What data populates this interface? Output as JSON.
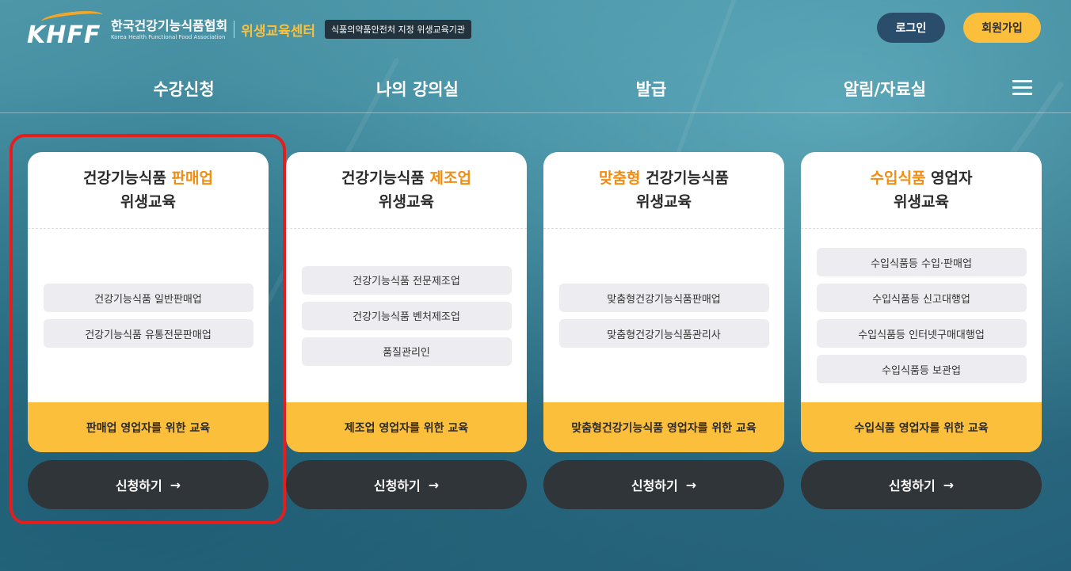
{
  "header": {
    "logo_text": "KHFF",
    "org_name": "한국건강기능식품협회",
    "org_name_en": "Korea Health Functional Food Association",
    "center_name": "위생교육센터",
    "badge": "식품의약품안전처 지정 위생교육기관",
    "login_label": "로그인",
    "join_label": "회원가입"
  },
  "nav": {
    "items": [
      "수강신청",
      "나의 강의실",
      "발급",
      "알림/자료실"
    ],
    "menu_icon": "hamburger-icon"
  },
  "cards": [
    {
      "title_pre": "건강기능식품 ",
      "title_accent": "판매업",
      "title_post": "",
      "title_line2": "위생교육",
      "items": [
        "건강기능식품 일반판매업",
        "건강기능식품 유통전문판매업"
      ],
      "footer": "판매업 영업자를 위한 교육",
      "button": "신청하기",
      "button_icon": "arrow-right-icon"
    },
    {
      "title_pre": "건강기능식품 ",
      "title_accent": "제조업",
      "title_post": "",
      "title_line2": "위생교육",
      "items": [
        "건강기능식품 전문제조업",
        "건강기능식품 벤처제조업",
        "품질관리인"
      ],
      "footer": "제조업 영업자를 위한 교육",
      "button": "신청하기",
      "button_icon": "arrow-right-icon"
    },
    {
      "title_pre": "",
      "title_accent": "맞춤형",
      "title_post": " 건강기능식품",
      "title_line2": "위생교육",
      "items": [
        "맞춤형건강기능식품판매업",
        "맞춤형건강기능식품관리사"
      ],
      "footer": "맞춤형건강기능식품 영업자를 위한 교육",
      "button": "신청하기",
      "button_icon": "arrow-right-icon"
    },
    {
      "title_pre": "",
      "title_accent": "수입식품",
      "title_post": " 영업자",
      "title_line2": "위생교육",
      "items": [
        "수입식품등 수입·판매업",
        "수입식품등 신고대행업",
        "수입식품등 인터넷구매대행업",
        "수입식품등 보관업"
      ],
      "footer": "수입식품 영업자를 위한 교육",
      "button": "신청하기",
      "button_icon": "arrow-right-icon"
    }
  ],
  "colors": {
    "accent_orange": "#f28c0f",
    "footer_yellow": "#fbbf3c",
    "button_dark": "#2f3538",
    "highlight_red": "#e41e1e"
  }
}
